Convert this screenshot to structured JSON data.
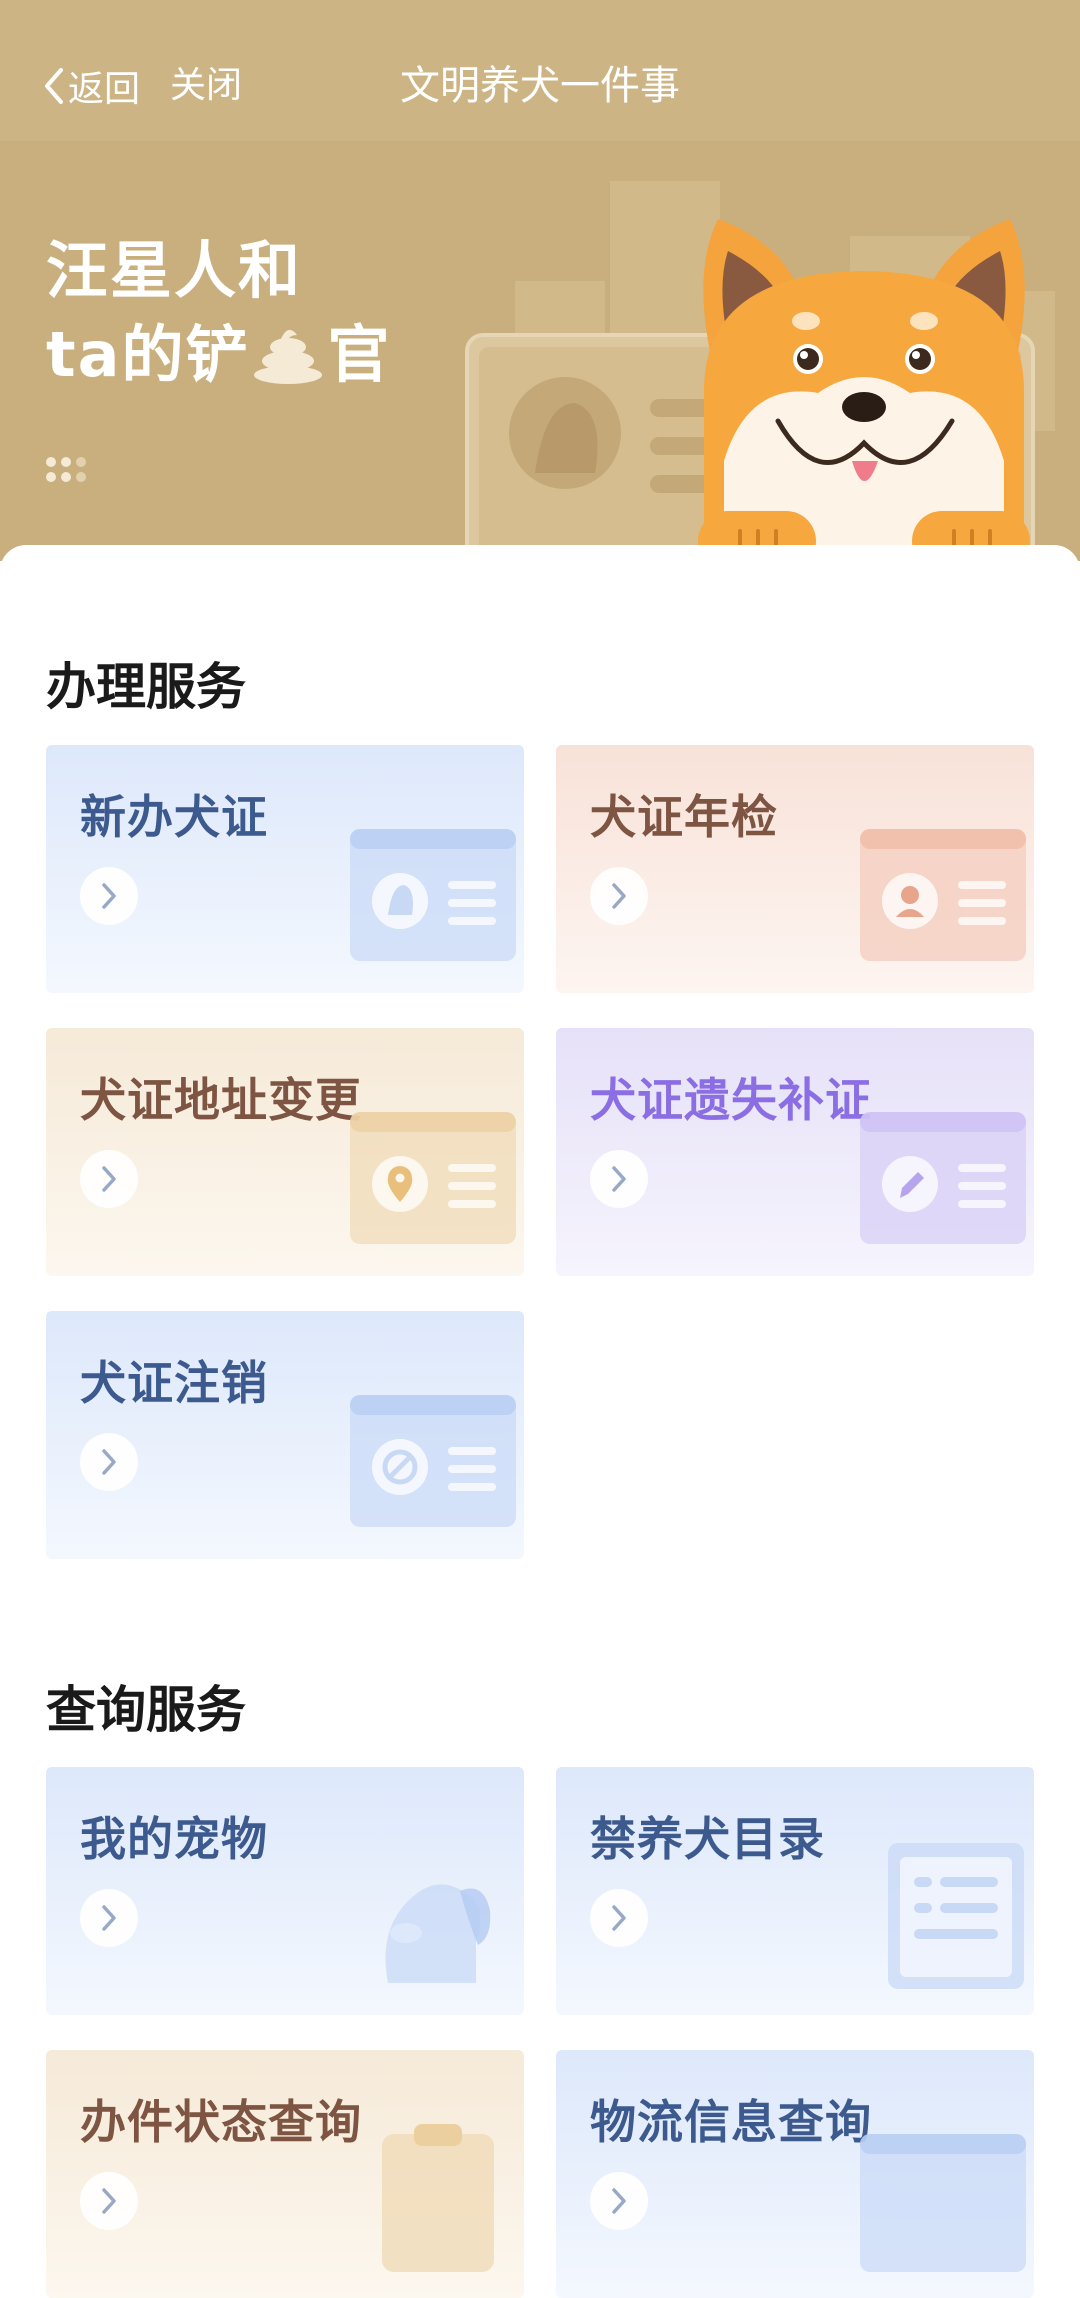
{
  "header": {
    "back_label": "返回",
    "close_label": "关闭",
    "title": "文明养犬一件事"
  },
  "banner": {
    "title_line1": "汪星人和",
    "title_line2_pre": "ta的铲",
    "title_line2_post": "官",
    "poop_icon": "poop-icon"
  },
  "handle_section": {
    "title": "办理服务",
    "cards": [
      {
        "label": "新办犬证",
        "theme": "blue",
        "icon": "dog-id-card-icon"
      },
      {
        "label": "犬证年检",
        "theme": "pink",
        "icon": "person-id-card-icon"
      },
      {
        "label": "犬证地址变更",
        "theme": "beige",
        "icon": "location-card-icon"
      },
      {
        "label": "犬证遗失补证",
        "theme": "purple",
        "icon": "pencil-card-icon"
      },
      {
        "label": "犬证注销",
        "theme": "blue",
        "icon": "cancel-card-icon"
      }
    ]
  },
  "query_section": {
    "title": "查询服务",
    "cards": [
      {
        "label": "我的宠物",
        "theme": "blue",
        "icon": "dog-head-icon"
      },
      {
        "label": "禁养犬目录",
        "theme": "blue",
        "icon": "list-document-icon"
      },
      {
        "label": "办件状态查询",
        "theme": "beige",
        "icon": "clipboard-icon"
      },
      {
        "label": "物流信息查询",
        "theme": "blue",
        "icon": "card-icon"
      }
    ]
  },
  "colors": {
    "header_bg": "#cdb485",
    "banner_bg": "#c9af7d",
    "text_blue": "#3d5a8e",
    "text_brown": "#7e5442",
    "text_purple": "#8b6ee3"
  }
}
